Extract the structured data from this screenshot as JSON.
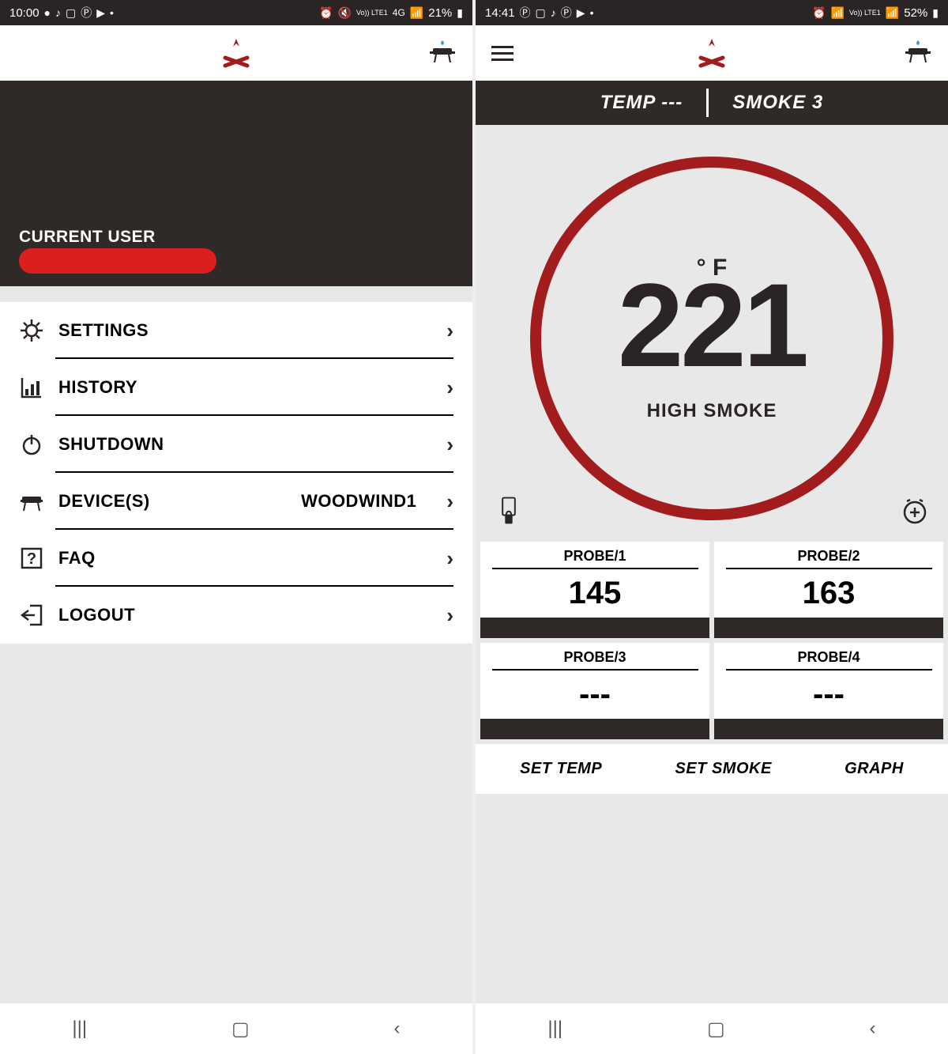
{
  "left": {
    "status": {
      "time": "10:00",
      "battery": "21%",
      "network": "4G"
    },
    "user_label": "CURRENT USER",
    "menu": [
      {
        "icon": "gear",
        "label": "SETTINGS"
      },
      {
        "icon": "chart",
        "label": "HISTORY"
      },
      {
        "icon": "power",
        "label": "SHUTDOWN"
      },
      {
        "icon": "grill",
        "label": "DEVICE(S)",
        "value": "WOODWIND1"
      },
      {
        "icon": "help",
        "label": "FAQ"
      },
      {
        "icon": "logout",
        "label": "LOGOUT"
      }
    ]
  },
  "right": {
    "status": {
      "time": "14:41",
      "battery": "52%"
    },
    "temp_bar": {
      "temp_label": "TEMP ---",
      "smoke_label": "SMOKE 3"
    },
    "gauge": {
      "unit": "° F",
      "value": "221",
      "mode": "HIGH SMOKE"
    },
    "probes": [
      {
        "label": "PROBE/1",
        "value": "145"
      },
      {
        "label": "PROBE/2",
        "value": "163"
      },
      {
        "label": "PROBE/3",
        "value": "---"
      },
      {
        "label": "PROBE/4",
        "value": "---"
      }
    ],
    "buttons": {
      "set_temp": "SET TEMP",
      "set_smoke": "SET SMOKE",
      "graph": "GRAPH"
    }
  },
  "colors": {
    "brand": "#a31c1d",
    "dark": "#2f2a28"
  }
}
